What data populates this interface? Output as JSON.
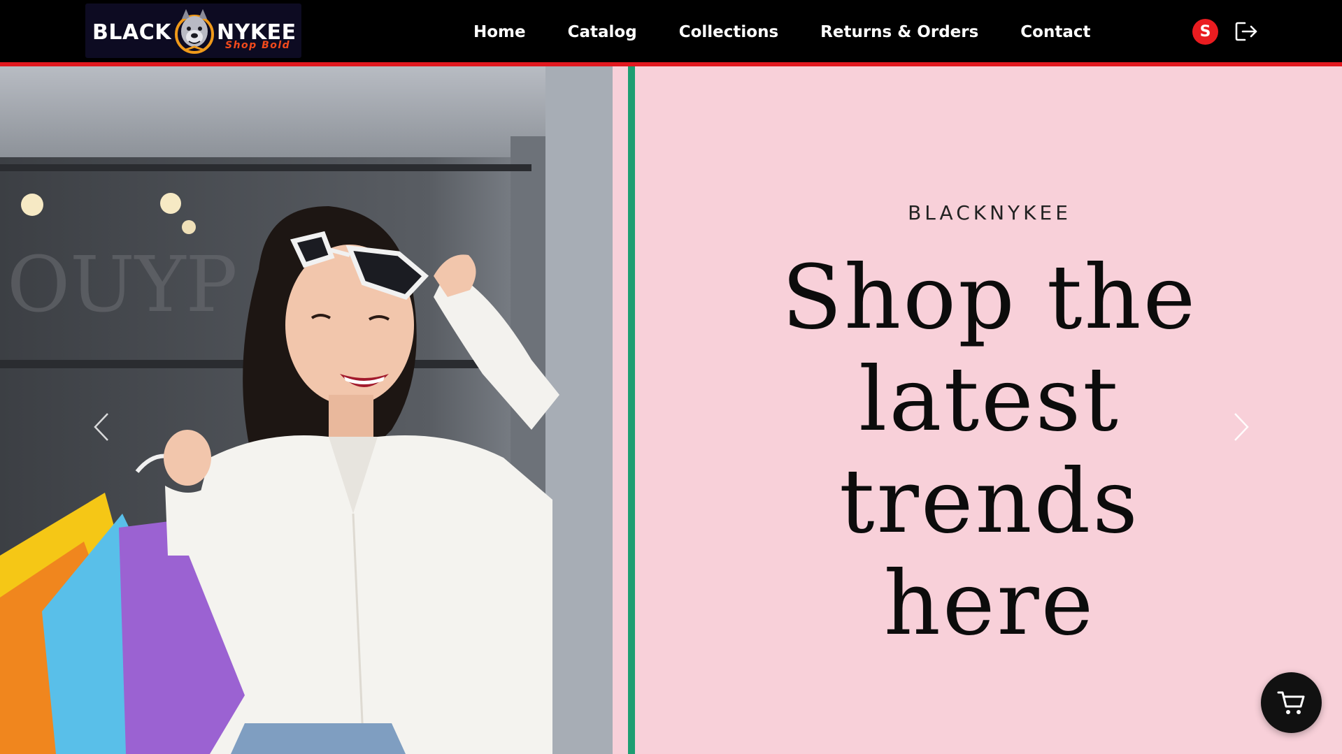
{
  "brand": {
    "logo_left": "BLACK",
    "logo_right": "NYKEE",
    "logo_tagline": "Shop Bold"
  },
  "nav": {
    "items": [
      {
        "label": "Home"
      },
      {
        "label": "Catalog"
      },
      {
        "label": "Collections"
      },
      {
        "label": "Returns & Orders"
      },
      {
        "label": "Contact"
      }
    ],
    "avatar_initial": "S",
    "logout_icon": "logout-icon"
  },
  "hero": {
    "eyebrow": "BLACKNYKEE",
    "headline": "Shop the latest trends here",
    "photo_alt": "Smiling woman holding colorful shopping bags with sunglasses on head",
    "prev_icon": "chevron-left-icon",
    "next_icon": "chevron-right-icon"
  },
  "cart": {
    "icon": "shopping-cart-icon"
  },
  "colors": {
    "nav_bg": "#000000",
    "nav_border": "#e2181f",
    "hero_bg": "#f8d0d9",
    "divider": "#1d9e72",
    "avatar_bg": "#ea1c20",
    "cart_bg": "#111111"
  }
}
